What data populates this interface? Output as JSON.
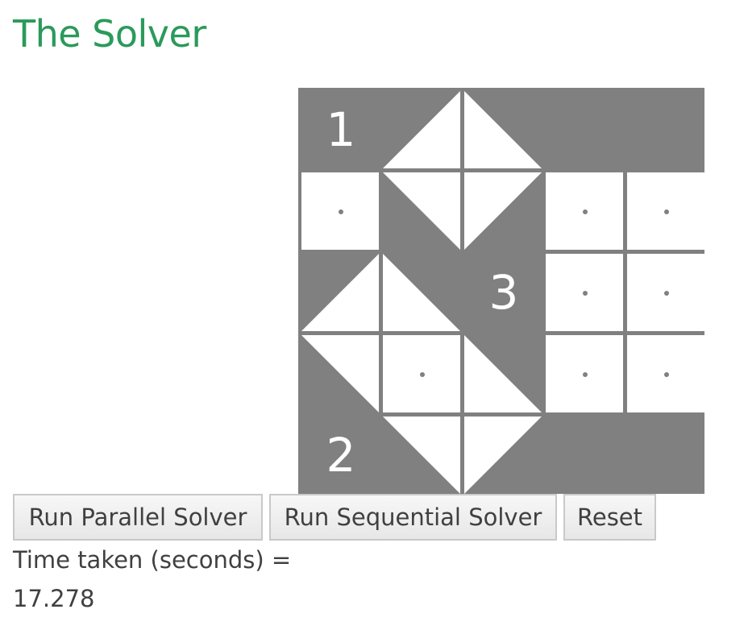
{
  "page": {
    "title": "The Solver",
    "title_color": "#2a9a5a"
  },
  "board": {
    "rows": 5,
    "cols": 5,
    "cell_fill": "#808080",
    "cells": [
      [
        {
          "kind": "black",
          "number": "1"
        },
        {
          "kind": "triangle",
          "corner": "top-left"
        },
        {
          "kind": "triangle",
          "corner": "top-right"
        },
        {
          "kind": "black"
        },
        {
          "kind": "black"
        }
      ],
      [
        {
          "kind": "dot"
        },
        {
          "kind": "triangle",
          "corner": "bottom-left"
        },
        {
          "kind": "triangle",
          "corner": "bottom-right"
        },
        {
          "kind": "dot"
        },
        {
          "kind": "dot"
        }
      ],
      [
        {
          "kind": "triangle",
          "corner": "top-left"
        },
        {
          "kind": "triangle",
          "corner": "top-right"
        },
        {
          "kind": "black",
          "number": "3"
        },
        {
          "kind": "dot"
        },
        {
          "kind": "dot"
        }
      ],
      [
        {
          "kind": "triangle",
          "corner": "bottom-left"
        },
        {
          "kind": "dot"
        },
        {
          "kind": "triangle",
          "corner": "top-right"
        },
        {
          "kind": "dot"
        },
        {
          "kind": "dot"
        }
      ],
      [
        {
          "kind": "black",
          "number": "2"
        },
        {
          "kind": "triangle",
          "corner": "bottom-left"
        },
        {
          "kind": "triangle",
          "corner": "bottom-right"
        },
        {
          "kind": "black"
        },
        {
          "kind": "black"
        }
      ]
    ]
  },
  "controls": {
    "parallel_label": "Run Parallel Solver",
    "sequential_label": "Run Sequential Solver",
    "reset_label": "Reset"
  },
  "result": {
    "time_label": "Time taken (seconds) =",
    "time_value": "17.278"
  }
}
